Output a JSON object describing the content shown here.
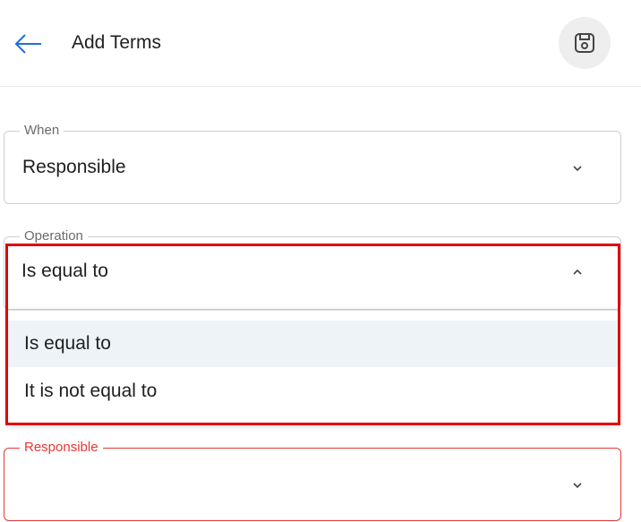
{
  "header": {
    "title": "Add Terms",
    "back_icon": "arrow-left-icon",
    "save_icon": "floppy-disk-icon"
  },
  "fields": {
    "when": {
      "label": "When",
      "value": "Responsible"
    },
    "operation": {
      "label": "Operation",
      "value": "Is equal to",
      "options": [
        "Is equal to",
        "It is not equal to"
      ]
    },
    "responsible": {
      "label": "Responsible",
      "value": ""
    }
  },
  "colors": {
    "accent": "#1e6fd9",
    "error": "#e53935",
    "highlight": "#e00000"
  }
}
